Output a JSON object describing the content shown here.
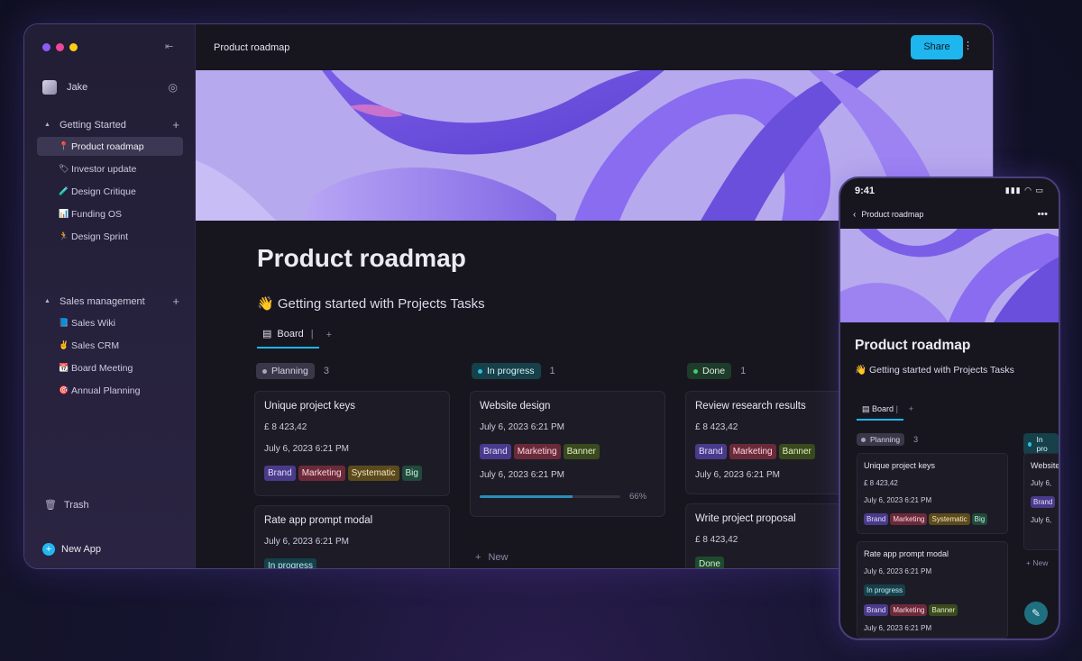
{
  "sidebar": {
    "user_name": "Jake",
    "sections": [
      {
        "label": "Getting Started",
        "items": [
          {
            "emoji": "📍",
            "label": "Product roadmap",
            "active": true
          },
          {
            "emoji": "🏷",
            "label": "Investor update"
          },
          {
            "emoji": "🧪",
            "label": "Design Critique"
          },
          {
            "emoji": "📊",
            "label": "Funding OS"
          },
          {
            "emoji": "🏃",
            "label": "Design Sprint"
          }
        ]
      },
      {
        "label": "Sales management",
        "items": [
          {
            "emoji": "📘",
            "label": "Sales Wiki"
          },
          {
            "emoji": "✌",
            "label": "Sales CRM"
          },
          {
            "emoji": "📆",
            "label": "Board Meeting"
          },
          {
            "emoji": "🎯",
            "label": "Annual Planning"
          }
        ]
      }
    ],
    "trash_label": "Trash",
    "new_app_label": "New App"
  },
  "topbar": {
    "title": "Product roadmap",
    "share_label": "Share",
    "more_icon": "⋮"
  },
  "page": {
    "title": "Product roadmap",
    "subtitle": "👋 Getting started with Projects Tasks",
    "tab_board": "Board",
    "tab_add": "+"
  },
  "board": {
    "columns": [
      {
        "label": "Planning",
        "count": "3"
      },
      {
        "label": "In progress",
        "count": "1"
      },
      {
        "label": "Done",
        "count": "1"
      }
    ],
    "cards": {
      "c1": {
        "title": "Unique project keys",
        "amount": "£ 8 423,42",
        "date": "July 6, 2023 6:21 PM",
        "tags": [
          "Brand",
          "Marketing",
          "Systematic",
          "Big"
        ]
      },
      "c2": {
        "title": "Rate app prompt modal",
        "date": "July 6, 2023 6:21 PM",
        "tag": "In progress"
      },
      "c3": {
        "title": "Website design",
        "date": "July 6, 2023 6:21 PM",
        "tags": [
          "Brand",
          "Marketing",
          "Banner"
        ],
        "date2": "July 6, 2023 6:21 PM",
        "progress_pct": "66%",
        "progress": 0.66
      },
      "c4": {
        "title": "Review research results",
        "amount": "£ 8 423,42",
        "tags": [
          "Brand",
          "Marketing",
          "Banner"
        ],
        "date": "July 6, 2023 6:21 PM"
      },
      "c5": {
        "title": "Write project proposal",
        "amount": "£ 8 423,42",
        "tag": "Done"
      }
    },
    "new_label": "New"
  },
  "phone": {
    "time": "9:41",
    "status": "▮▮▮ ◠ ▭",
    "nav_title": "Product roadmap",
    "nav_more": "•••",
    "title": "Product roadmap",
    "subtitle": "👋 Getting started with Projects Tasks",
    "tab_board": "Board",
    "tab_add": "+",
    "columns": [
      {
        "label": "Planning",
        "count": "3"
      },
      {
        "label": "In pro"
      }
    ],
    "card1": {
      "title": "Unique project keys",
      "amount": "£ 8 423,42",
      "date": "July 6, 2023 6:21 PM",
      "tags": [
        "Brand",
        "Marketing",
        "Systematic",
        "Big"
      ]
    },
    "card2": {
      "title": "Rate app prompt modal",
      "date": "July 6, 2023 6:21 PM",
      "tag": "In progress",
      "tags": [
        "Brand",
        "Marketing",
        "Banner"
      ],
      "date2": "July 6, 2023 6:21 PM"
    },
    "card3": {
      "title": "Website",
      "date": "July 6,",
      "tag": "Brand",
      "date2": "July 6,"
    },
    "new_label": "+ New"
  }
}
